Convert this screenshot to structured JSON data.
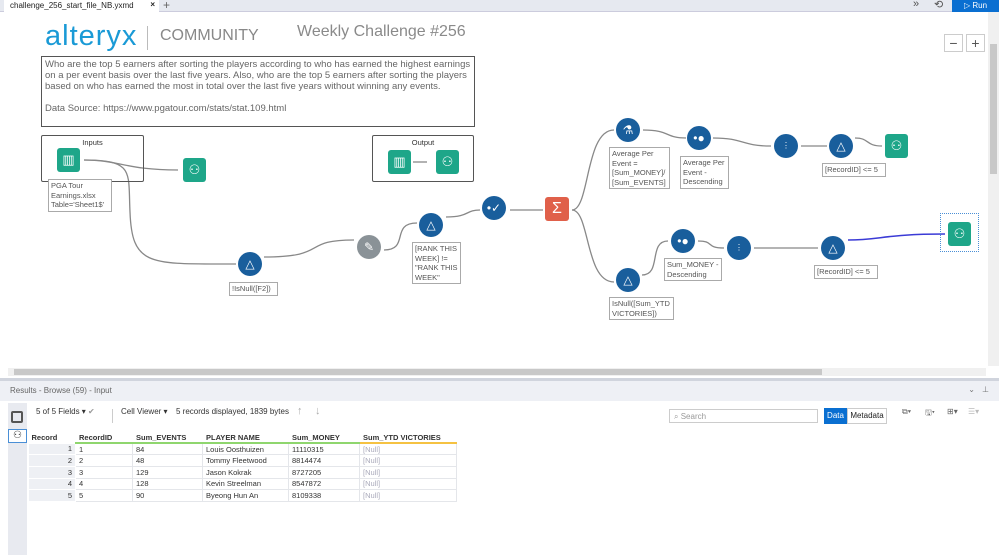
{
  "tab": {
    "title": "challenge_256_start_file_NB.yxmd",
    "close": "×",
    "new": "+"
  },
  "topright": {
    "more": "»",
    "history": "⟲",
    "run": "▷ Run"
  },
  "header": {
    "logo": "alteryx",
    "community": "COMMUNITY",
    "title": "Weekly Challenge #256"
  },
  "zoom": {
    "minus": "−",
    "plus": "+"
  },
  "comment": {
    "line1": "Who are the top 5 earners after sorting the players according to who has earned the highest earnings on a per event basis over the last five years. Also, who are the top 5 earners after sorting the players based on who has earned the most in total over the last five years without winning any events.",
    "line2": "Data Source: https://www.pgatour.com/stats/stat.109.html"
  },
  "groups": {
    "inputs": "Inputs",
    "output": "Output"
  },
  "annotations": {
    "input": "PGA Tour Earnings.xlsx Table='Sheet1$'",
    "filter1": "!IsNull([F2])",
    "filter2": "[RANK THIS WEEK] != \"RANK THIS WEEK\"",
    "formula": "Average Per Event = [Sum_MONEY]/ [Sum_EVENTS]",
    "sort1": "Average Per Event - Descending",
    "filter3": "[RecordID] <= 5",
    "filter4": "IsNull([Sum_YTD VICTORIES])",
    "sort2": "Sum_MONEY - Descending",
    "filter5": "[RecordID] <= 5"
  },
  "results": {
    "header": "Results - Browse (59) - Input",
    "fields": "5 of 5 Fields",
    "cell_viewer": "Cell Viewer",
    "summary": "5 records displayed, 1839 bytes",
    "search_placeholder": "Search",
    "data_tab": "Data",
    "metadata_tab": "Metadata",
    "columns": [
      "Record",
      "RecordID",
      "Sum_EVENTS",
      "PLAYER NAME",
      "Sum_MONEY",
      "Sum_YTD VICTORIES"
    ],
    "rows": [
      [
        "1",
        "1",
        "84",
        "Louis Oosthuizen",
        "11110315",
        "[Null]"
      ],
      [
        "2",
        "2",
        "48",
        "Tommy Fleetwood",
        "8814474",
        "[Null]"
      ],
      [
        "3",
        "3",
        "129",
        "Jason Kokrak",
        "8727205",
        "[Null]"
      ],
      [
        "4",
        "4",
        "128",
        "Kevin Streelman",
        "8547872",
        "[Null]"
      ],
      [
        "5",
        "5",
        "90",
        "Byeong Hun An",
        "8109338",
        "[Null]"
      ]
    ]
  },
  "colors": {
    "accent": "#0a6fd1",
    "tool_blue": "#195e9c",
    "tool_green": "#1ea689",
    "summarize": "#e0604a"
  }
}
